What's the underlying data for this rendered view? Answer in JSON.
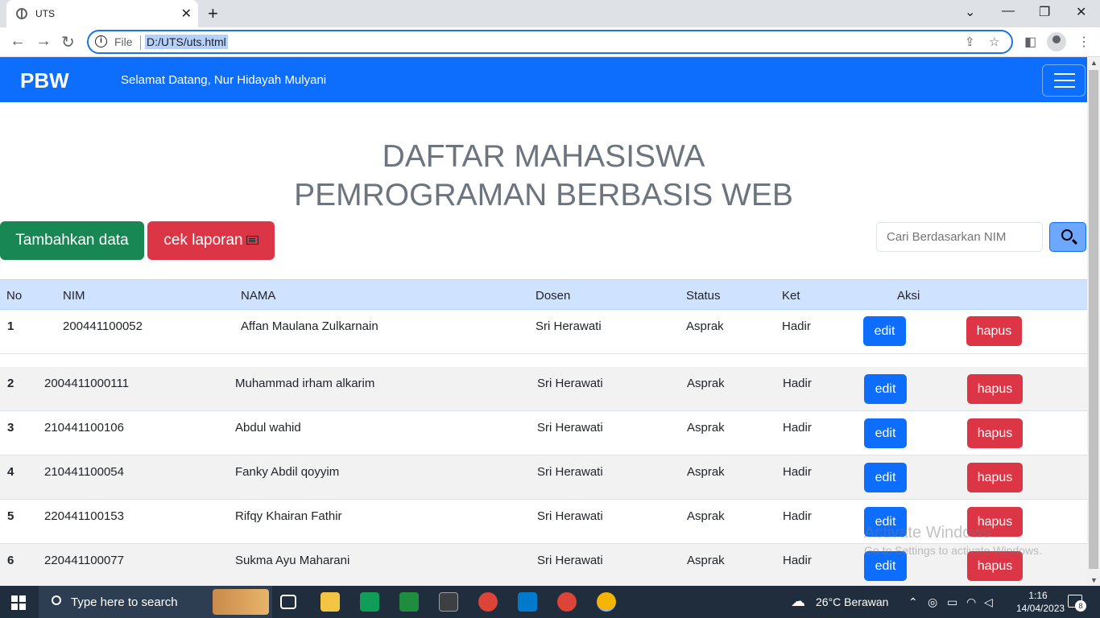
{
  "browser": {
    "tab_title": "UTS",
    "url_scheme": "File",
    "url": "D:/UTS/uts.html"
  },
  "navbar": {
    "brand": "PBW",
    "welcome": "Selamat Datang, Nur Hidayah Mulyani"
  },
  "heading": {
    "line1": "DAFTAR MAHASISWA",
    "line2": "PEMROGRAMAN BERBASIS WEB"
  },
  "actions": {
    "add_label": "Tambahkan data",
    "report_label": "cek laporan",
    "search_placeholder": "Cari Berdasarkan NIM"
  },
  "table": {
    "headers": [
      "No",
      "NIM",
      "NAMA",
      "Dosen",
      "Status",
      "Ket",
      "Aksi"
    ],
    "edit_label": "edit",
    "delete_label": "hapus",
    "rows": [
      {
        "no": "1",
        "nim": "200441100052",
        "nama": "Affan Maulana Zulkarnain",
        "dosen": "Sri Herawati",
        "status": "Asprak",
        "ket": "Hadir"
      },
      {
        "no": "2",
        "nim": "2004411000111",
        "nama": "Muhammad irham alkarim",
        "dosen": "Sri Herawati",
        "status": "Asprak",
        "ket": "Hadir"
      },
      {
        "no": "3",
        "nim": "210441100106",
        "nama": "Abdul wahid",
        "dosen": "Sri Herawati",
        "status": "Asprak",
        "ket": "Hadir"
      },
      {
        "no": "4",
        "nim": "210441100054",
        "nama": "Fanky Abdil qoyyim",
        "dosen": "Sri Herawati",
        "status": "Asprak",
        "ket": "Hadir"
      },
      {
        "no": "5",
        "nim": "220441100153",
        "nama": "Rifqy Khairan Fathir",
        "dosen": "Sri Herawati",
        "status": "Asprak",
        "ket": "Hadir"
      },
      {
        "no": "6",
        "nim": "220441100077",
        "nama": "Sukma Ayu Maharani",
        "dosen": "Sri Herawati",
        "status": "Asprak",
        "ket": "Hadir"
      }
    ]
  },
  "watermark": {
    "line1": "Activate Windows",
    "line2": "Go to Settings to activate Windows."
  },
  "taskbar": {
    "search_placeholder": "Type here to search",
    "weather": "26°C  Berawan",
    "time": "1:16",
    "date": "14/04/2023",
    "notifications": "8"
  },
  "colors": {
    "primary": "#0d6efd",
    "success": "#198754",
    "danger": "#dc3545",
    "table_head": "#cfe2ff"
  }
}
